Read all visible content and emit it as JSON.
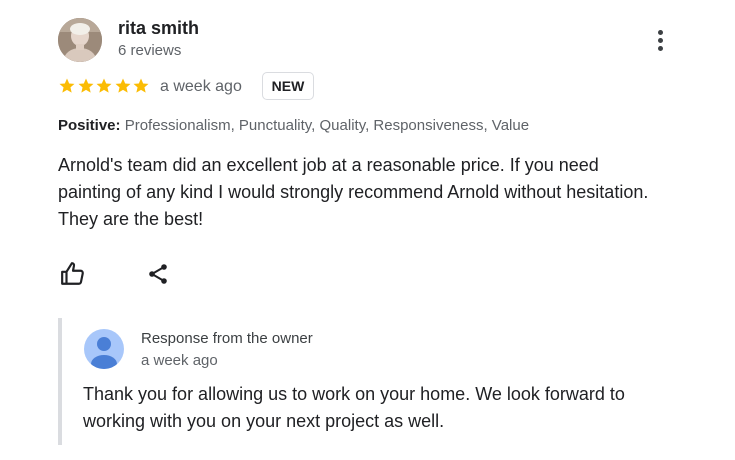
{
  "reviewer": {
    "name": "rita smith",
    "reviews_count": "6 reviews",
    "avatar_icon": "person-photo-avatar"
  },
  "review": {
    "rating": 5,
    "rating_max": 5,
    "star_color": "#fbbc04",
    "time": "a week ago",
    "badge": "NEW",
    "positive_label": "Positive:",
    "positive_values": "Professionalism, Punctuality, Quality, Responsiveness, Value",
    "text": "Arnold's team did an excellent job at a reasonable price. If you need painting of any kind I would strongly recommend Arnold without hesitation. They are the best!"
  },
  "actions": {
    "like_icon": "thumbs-up-icon",
    "share_icon": "share-icon",
    "menu_icon": "more-vert-icon"
  },
  "owner_response": {
    "title": "Response from the owner",
    "time": "a week ago",
    "text": "Thank you for allowing us to work on your home. We look forward to working with you on your next project as well.",
    "avatar_color": "#a8c7fa",
    "avatar_figure_color": "#4a7fd6"
  }
}
